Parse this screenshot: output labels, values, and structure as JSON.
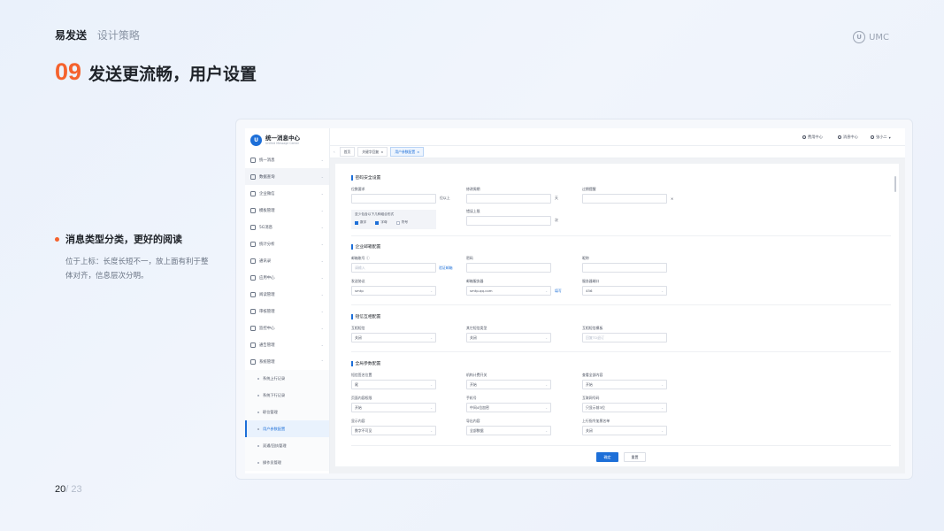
{
  "slide": {
    "brand": "易发送",
    "subtitle": "设计策略",
    "logo_text": "UMC",
    "title_number": "09",
    "title_text": "发送更流畅，用户设置",
    "feature_title": "消息类型分类，更好的阅读",
    "feature_desc": "位于上标：长度长短不一，放上面有利于整体对齐，信息层次分明。",
    "page_current": "20",
    "page_total": "/ 23",
    "accent_color": "#f5622d"
  },
  "app": {
    "logo_name": "统一消息中心",
    "logo_sub": "Unified Message Center",
    "menu": [
      {
        "label": "统一消息",
        "icon": "message-icon"
      },
      {
        "label": "数据查询",
        "icon": "data-icon"
      },
      {
        "label": "企业微信",
        "icon": "wechat-icon"
      },
      {
        "label": "模板管理",
        "icon": "template-icon"
      },
      {
        "label": "5G消息",
        "icon": "signal-icon"
      },
      {
        "label": "统计分析",
        "icon": "chart-icon"
      },
      {
        "label": "通讯录",
        "icon": "contacts-icon"
      },
      {
        "label": "应用中心",
        "icon": "apps-icon"
      },
      {
        "label": "阅读管理",
        "icon": "read-icon"
      },
      {
        "label": "审核管理",
        "icon": "audit-icon"
      },
      {
        "label": "监控中心",
        "icon": "monitor-icon"
      },
      {
        "label": "通告管理",
        "icon": "notice-icon"
      },
      {
        "label": "系统管理",
        "icon": "system-icon"
      }
    ],
    "submenu": [
      {
        "label": "系统上行记录"
      },
      {
        "label": "系统下行记录"
      },
      {
        "label": "职位管理"
      },
      {
        "label": "用户参数配置"
      },
      {
        "label": "双通/回执管理"
      },
      {
        "label": "操作员管理"
      }
    ],
    "top_right": [
      "费用中心",
      "消息中心",
      "张小二"
    ],
    "tabs": [
      "首页",
      "关键字回复",
      "用户参数配置"
    ],
    "sections": [
      {
        "title": "密码安全设置"
      },
      {
        "title": "企业邮箱配置"
      },
      {
        "title": "短信互相配置"
      },
      {
        "title": "全局参数配置"
      }
    ],
    "password": {
      "f1_label": "位数要求",
      "f1_suffix": "位以上",
      "f2_label": "修改周期",
      "f2_suffix": "天",
      "f3_label": "过期提醒",
      "f4_label": "错误上限",
      "f4_suffix": "次",
      "combo_title": "至少包含以下几种组合形式",
      "combo_options": [
        "数字",
        "字母",
        "符号"
      ]
    },
    "mail": {
      "f1_label": "邮箱账号",
      "f1_placeholder": "请输入",
      "f1_link": "验证邮箱",
      "f2_label": "密码",
      "f3_label": "昵称",
      "f4_label": "发送协议",
      "f4_value": "smtp",
      "f5_label": "邮箱服务器",
      "f5_value": "smtp.qq.com",
      "f5_link": "填写",
      "f6_label": "服务器端口",
      "f6_value": "456"
    },
    "sms": {
      "f1_label": "互相短信",
      "f1_value": "关闭",
      "f2_label": "其它短信类型",
      "f2_value": "关闭",
      "f3_label": "互相短信模板",
      "f3_placeholder": "回复TD退订"
    },
    "global": {
      "f1_label": "短信签名位置",
      "f1_value": "尾",
      "f2_label": "机构计费开关",
      "f2_value": "开始",
      "f3_label": "查看全部内容",
      "f3_value": "开始",
      "f4_label": "页面内容权限",
      "f4_value": "开始",
      "f5_label": "手机号",
      "f5_value": "中间4位加密",
      "f6_label": "互联网号码",
      "f6_value": "只显示前3位",
      "f7_label": "显示内容",
      "f7_value": "数字不可见",
      "f8_label": "导出内容",
      "f8_value": "全部数据",
      "f9_label": "上行指令加黑名单",
      "f9_value": "关闭"
    },
    "buttons": {
      "confirm": "确定",
      "reset": "重置"
    },
    "primary_color": "#1d6fd8"
  }
}
